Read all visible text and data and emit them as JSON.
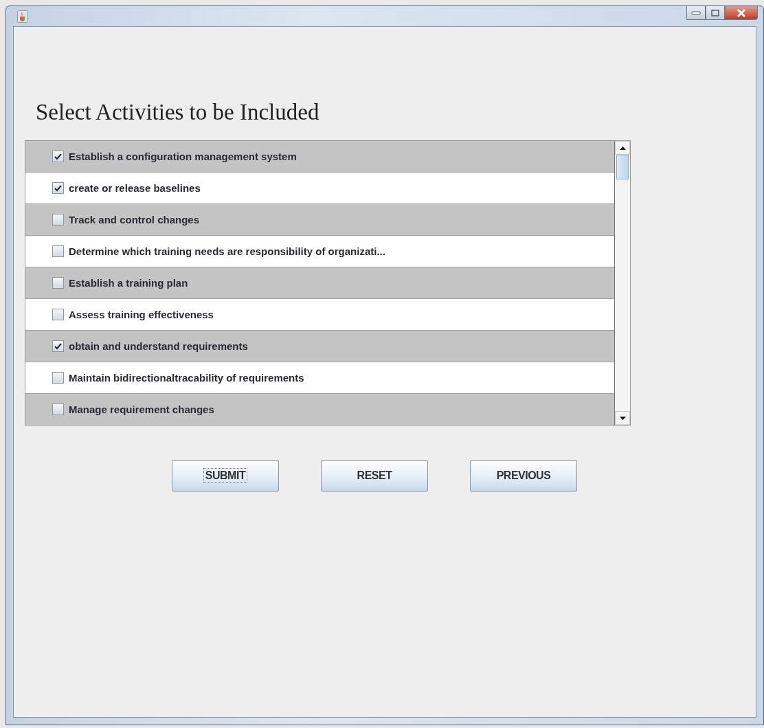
{
  "heading": "Select Activities to be Included",
  "activities": [
    {
      "label": "Establish a configuration management system",
      "checked": true
    },
    {
      "label": "create or release baselines",
      "checked": true
    },
    {
      "label": "Track and control changes",
      "checked": false
    },
    {
      "label": "Determine which training needs are responsibility of organizati...",
      "checked": false
    },
    {
      "label": "Establish a training plan",
      "checked": false
    },
    {
      "label": "Assess training effectiveness",
      "checked": false
    },
    {
      "label": "obtain and understand requirements",
      "checked": true
    },
    {
      "label": "Maintain bidirectionaltracability of requirements",
      "checked": false
    },
    {
      "label": "Manage requirement changes",
      "checked": false
    }
  ],
  "buttons": [
    {
      "label": "SUBMIT",
      "focused": true
    },
    {
      "label": "RESET",
      "focused": false
    },
    {
      "label": "PREVIOUS",
      "focused": false
    }
  ]
}
